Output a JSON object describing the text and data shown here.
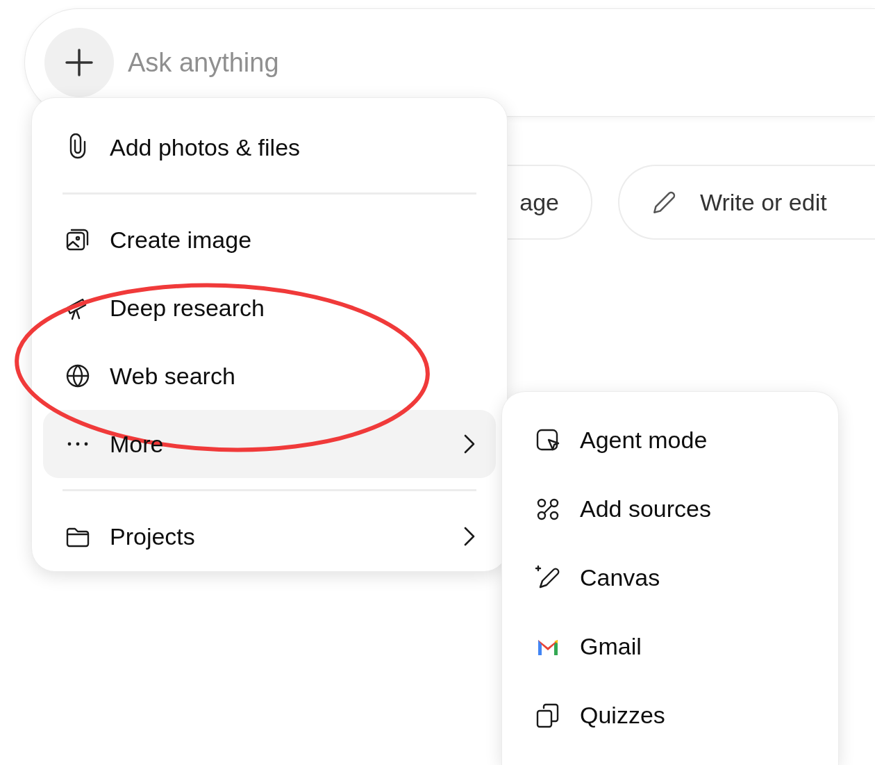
{
  "prompt": {
    "placeholder": "Ask anything"
  },
  "suggestions": [
    {
      "label": "age"
    },
    {
      "label": "Write or edit"
    }
  ],
  "menu": {
    "items": [
      {
        "kind": "item",
        "label": "Add photos & files",
        "selected": false,
        "has_submenu": false
      },
      {
        "kind": "divider"
      },
      {
        "kind": "item",
        "label": "Create image",
        "selected": false,
        "has_submenu": false
      },
      {
        "kind": "item",
        "label": "Deep research",
        "selected": false,
        "has_submenu": false
      },
      {
        "kind": "item",
        "label": "Web search",
        "selected": false,
        "has_submenu": false
      },
      {
        "kind": "item",
        "label": "More",
        "selected": true,
        "has_submenu": true
      },
      {
        "kind": "divider"
      },
      {
        "kind": "item",
        "label": "Projects",
        "selected": false,
        "has_submenu": true
      }
    ]
  },
  "submenu": {
    "items": [
      {
        "label": "Agent mode"
      },
      {
        "label": "Add sources"
      },
      {
        "label": "Canvas"
      },
      {
        "label": "Gmail"
      },
      {
        "label": "Quizzes"
      }
    ]
  }
}
